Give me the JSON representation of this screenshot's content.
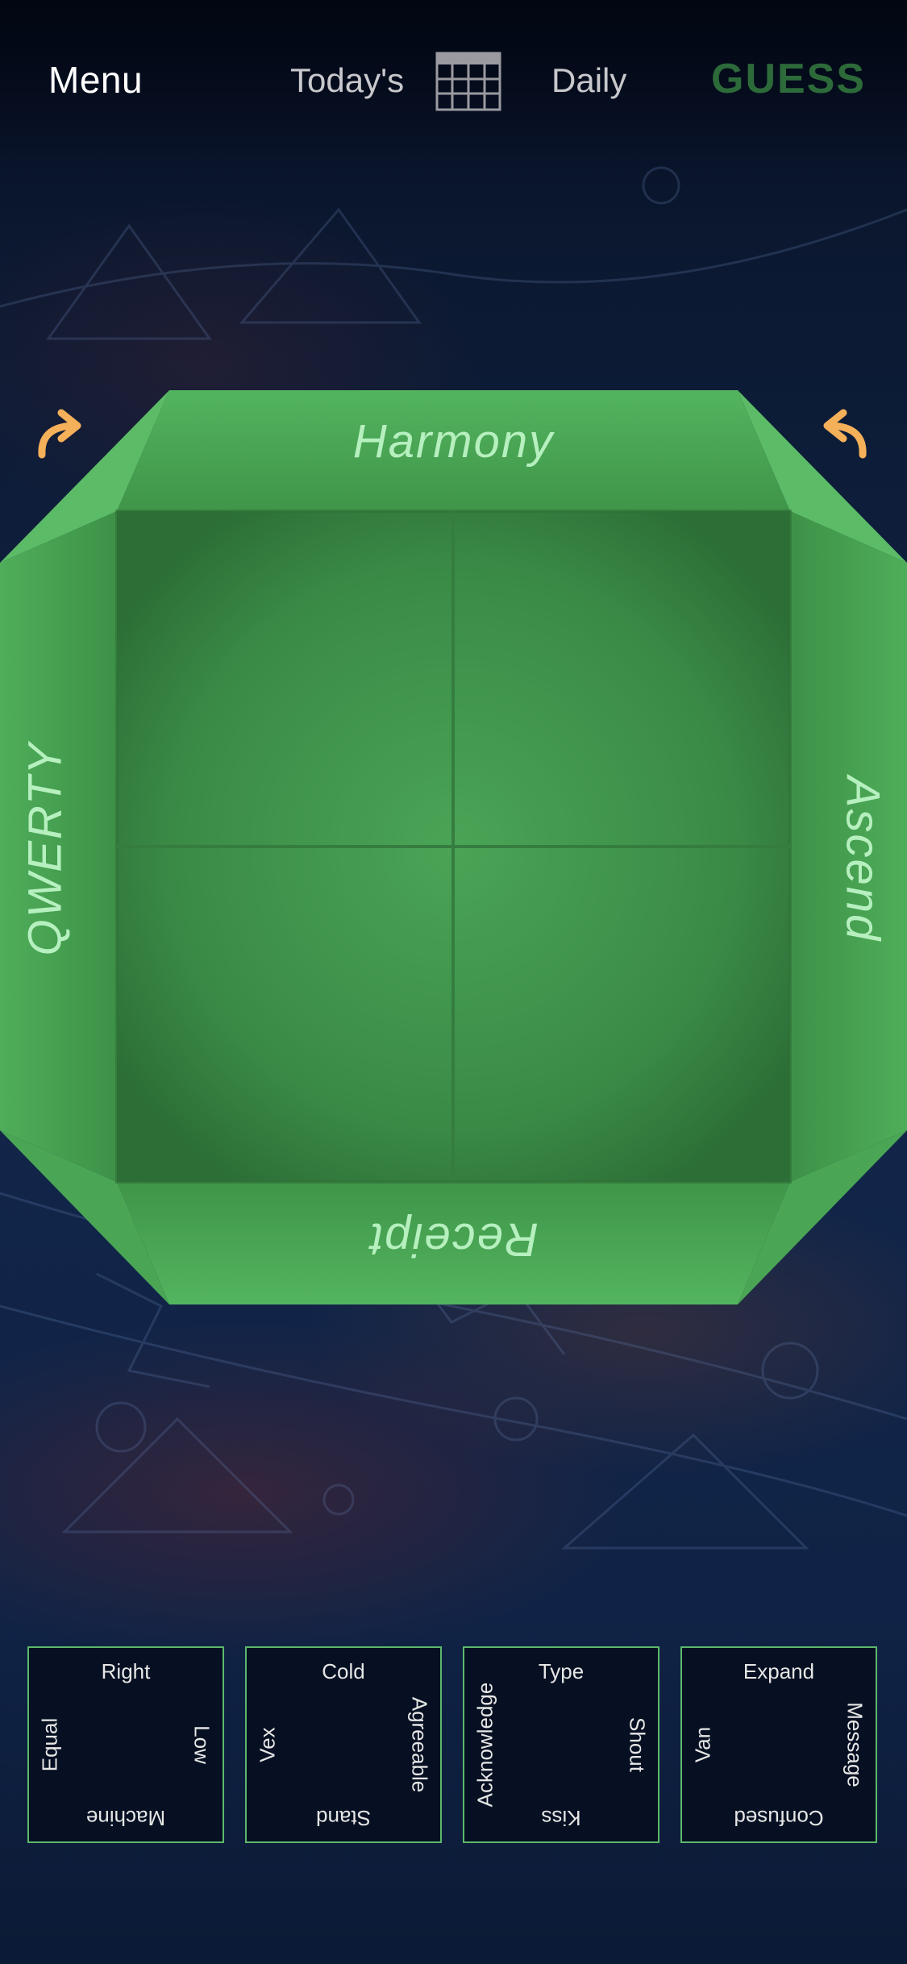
{
  "header": {
    "menu_label": "Menu",
    "todays_label": "Today's",
    "calendar_icon": "calendar-icon",
    "daily_label": "Daily",
    "guess_label": "GUESS"
  },
  "board": {
    "top": "Harmony",
    "right": "Ascend",
    "bottom": "Receipt",
    "left": "QWERTY",
    "rotate_left_icon": "rotate-clockwise-arrow-icon",
    "rotate_right_icon": "rotate-counterclockwise-arrow-icon"
  },
  "tiles": [
    {
      "top": "Right",
      "right": "Low",
      "bottom": "Machine",
      "left": "Equal"
    },
    {
      "top": "Cold",
      "right": "Agreeable",
      "bottom": "Stand",
      "left": "Vex"
    },
    {
      "top": "Type",
      "right": "Shout",
      "bottom": "Kiss",
      "left": "Acknowledge"
    },
    {
      "top": "Expand",
      "right": "Message",
      "bottom": "Confused",
      "left": "Van"
    }
  ],
  "colors": {
    "accent_green": "#4fae5a",
    "label_green": "#b6f0bf",
    "arrow_orange": "#f5b05a",
    "guess_green": "#2d6a3a",
    "tile_border": "#5cb86a"
  }
}
